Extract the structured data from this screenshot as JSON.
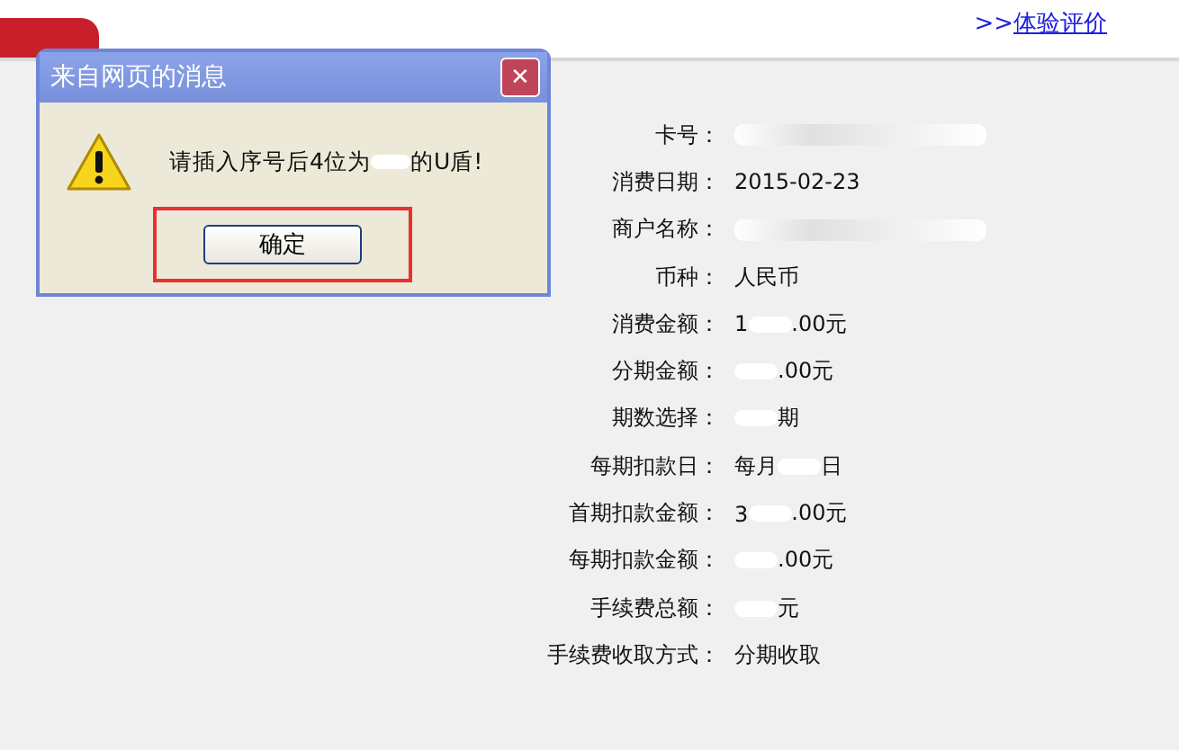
{
  "header": {
    "link_prefix": ">>",
    "link": "体验评价"
  },
  "details": [
    {
      "label": "卡号：",
      "redacted": true
    },
    {
      "label": "消费日期：",
      "value": "2015-02-23",
      "redacted": false
    },
    {
      "label": "商户名称：",
      "redacted": true
    },
    {
      "label": "币种：",
      "value": "人民币",
      "redacted": false
    },
    {
      "label": "消费金额：",
      "value": "1",
      "value_after": ".00元",
      "redacted": true
    },
    {
      "label": "分期金额：",
      "value": ".00元",
      "redacted": true
    },
    {
      "label": "期数选择：",
      "value": "期",
      "redacted": true
    },
    {
      "label": "每期扣款日：",
      "value": "每月",
      "value_after": "日",
      "redacted": true
    },
    {
      "label": "首期扣款金额：",
      "value": "3",
      "value_after": ".00元",
      "redacted": true
    },
    {
      "label": "每期扣款金额：",
      "value": ".00元",
      "redacted": true
    },
    {
      "label": "手续费总额：",
      "value": "元",
      "redacted": true
    },
    {
      "label": "手续费收取方式：",
      "value": "分期收取",
      "redacted": false
    }
  ],
  "dialog": {
    "title": "来自网页的消息",
    "close": "✕",
    "message_before": "请插入序号后4位为",
    "message_after": "的U盾!",
    "button": "确定",
    "button_highlighted": true
  }
}
